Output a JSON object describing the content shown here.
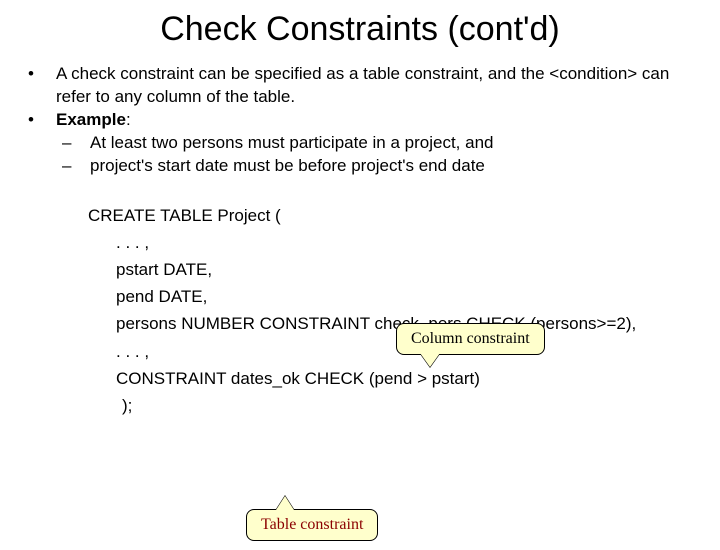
{
  "title": "Check Constraints (cont'd)",
  "bullets": {
    "b1": "A check constraint can be specified as a table constraint, and the <condition> can refer to any column of the table.",
    "b2_label": "Example",
    "b2_colon": ":",
    "b2_sub1": "At least two persons must participate in a project, and",
    "b2_sub2": "project's start date must be before project's end date"
  },
  "code": {
    "l1": "CREATE TABLE Project  (",
    "l2": ". . . ,",
    "l3": "pstart DATE,",
    "l4": "pend DATE,",
    "l5": "persons NUMBER CONSTRAINT check_pers CHECK (persons>=2),",
    "l6": ". . . ,",
    "l7": "CONSTRAINT dates_ok CHECK (pend > pstart)",
    "l8": ");"
  },
  "callouts": {
    "column": "Column constraint",
    "table": "Table constraint"
  }
}
